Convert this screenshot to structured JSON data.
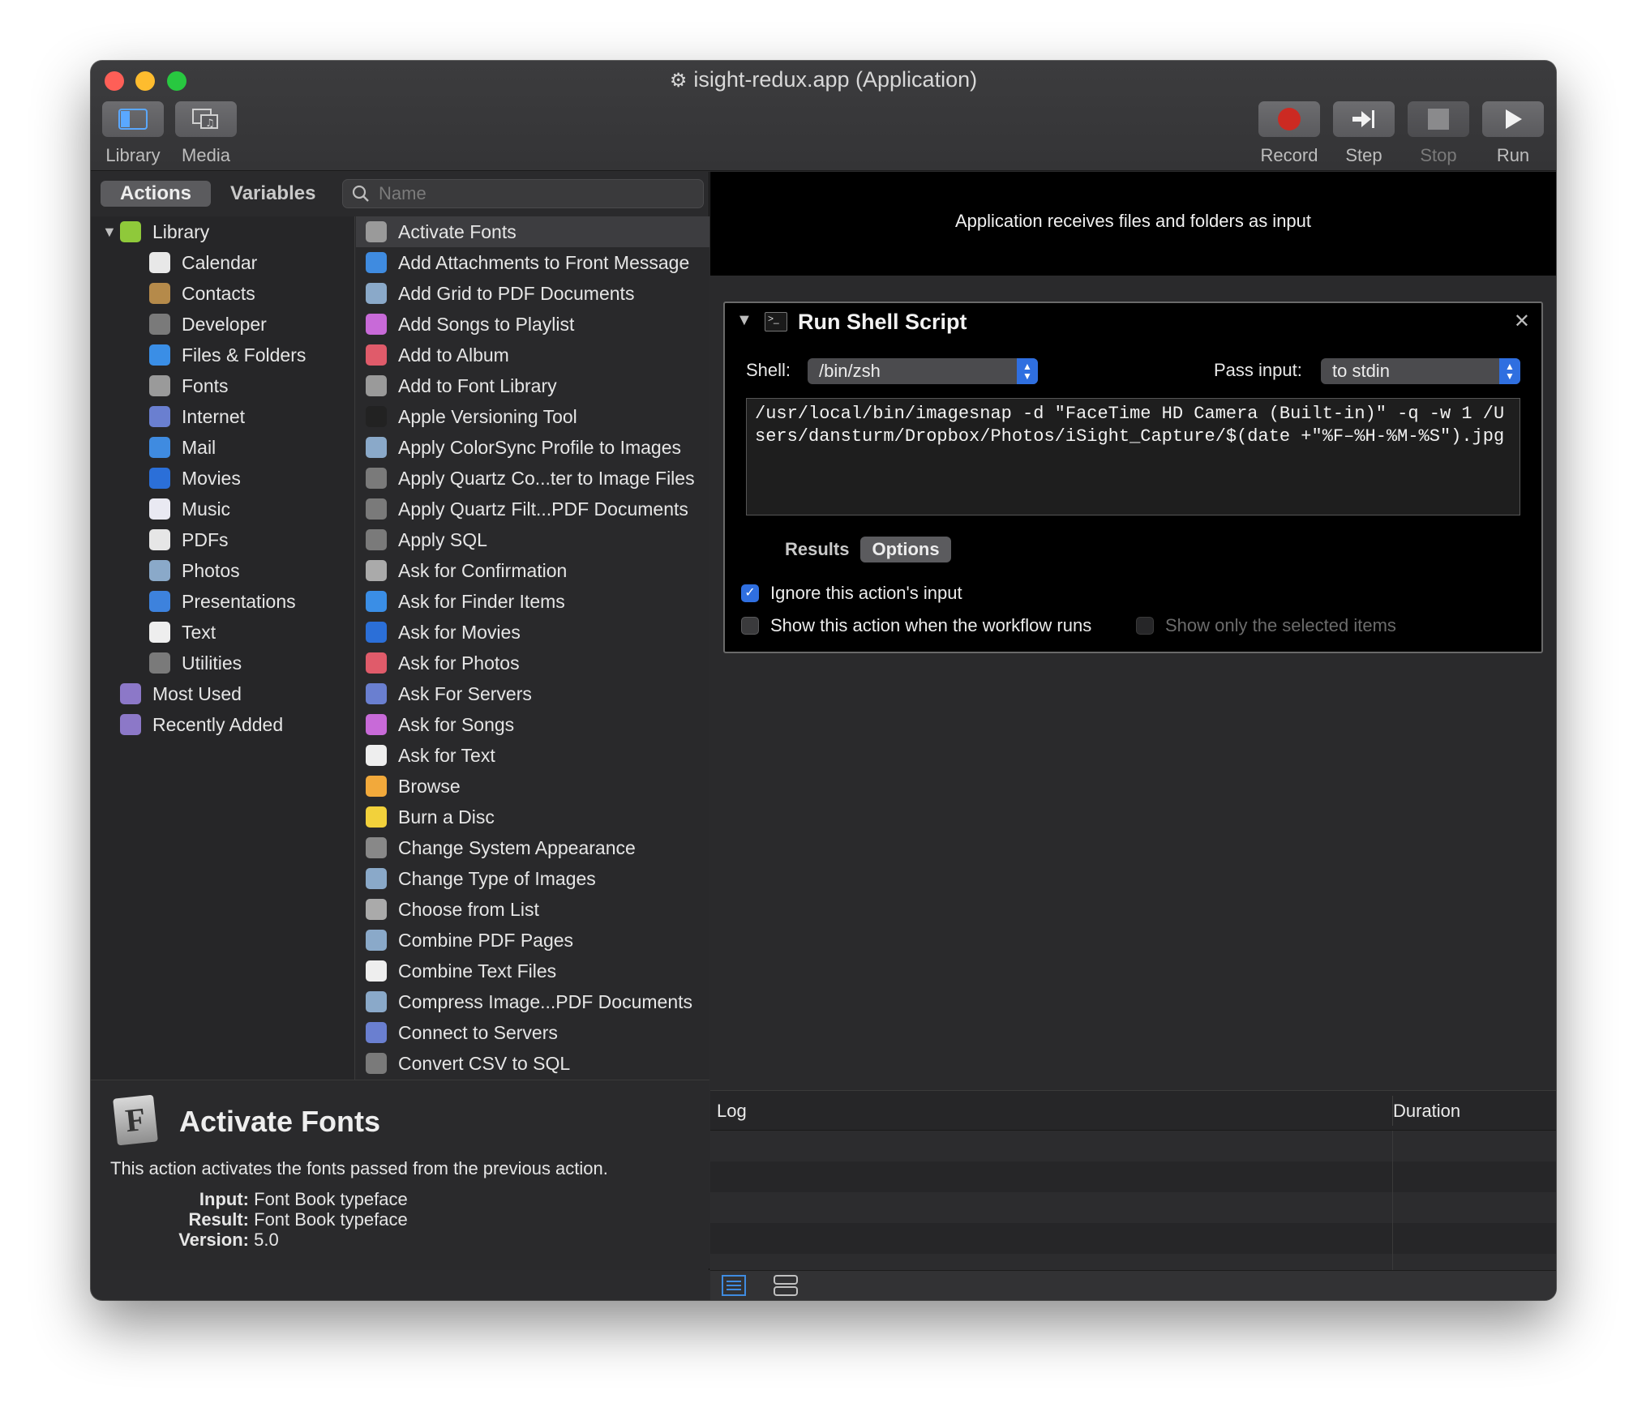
{
  "window": {
    "title": "isight-redux.app (Application)"
  },
  "toolbar": {
    "library_label": "Library",
    "media_label": "Media",
    "record_label": "Record",
    "step_label": "Step",
    "stop_label": "Stop",
    "run_label": "Run"
  },
  "left_tabs": {
    "actions": "Actions",
    "variables": "Variables"
  },
  "search": {
    "placeholder": "Name",
    "value": ""
  },
  "categories": [
    {
      "label": "Library",
      "icon": "library-icon",
      "color": "#8fc93a"
    },
    {
      "label": "Calendar",
      "icon": "calendar-icon",
      "color": "#e8e8e8"
    },
    {
      "label": "Contacts",
      "icon": "contacts-icon",
      "color": "#b58a4a"
    },
    {
      "label": "Developer",
      "icon": "developer-icon",
      "color": "#7a7a7a"
    },
    {
      "label": "Files & Folders",
      "icon": "finder-icon",
      "color": "#3a8ee6"
    },
    {
      "label": "Fonts",
      "icon": "fonts-icon",
      "color": "#9a9a9a"
    },
    {
      "label": "Internet",
      "icon": "globe-icon",
      "color": "#6a7fd0"
    },
    {
      "label": "Mail",
      "icon": "mail-icon",
      "color": "#3f8be0"
    },
    {
      "label": "Movies",
      "icon": "movies-icon",
      "color": "#2b6fd8"
    },
    {
      "label": "Music",
      "icon": "music-icon",
      "color": "#e9e9f2"
    },
    {
      "label": "PDFs",
      "icon": "pdf-icon",
      "color": "#e6e6e6"
    },
    {
      "label": "Photos",
      "icon": "photos-icon",
      "color": "#8aa9c9"
    },
    {
      "label": "Presentations",
      "icon": "presentations-icon",
      "color": "#3d82dd"
    },
    {
      "label": "Text",
      "icon": "text-icon",
      "color": "#eeeeee"
    },
    {
      "label": "Utilities",
      "icon": "utilities-icon",
      "color": "#7a7a7a"
    },
    {
      "label": "Most Used",
      "icon": "smart-folder-icon",
      "color": "#8c78c8"
    },
    {
      "label": "Recently Added",
      "icon": "smart-folder-icon",
      "color": "#8c78c8"
    }
  ],
  "actions": [
    {
      "label": "Activate Fonts",
      "icon": "fonts-icon",
      "color": "#9a9a9a"
    },
    {
      "label": "Add Attachments to Front Message",
      "icon": "mail-icon",
      "color": "#3f8be0"
    },
    {
      "label": "Add Grid to PDF Documents",
      "icon": "preview-icon",
      "color": "#8aa9c9"
    },
    {
      "label": "Add Songs to Playlist",
      "icon": "music-icon",
      "color": "#c86ad8"
    },
    {
      "label": "Add to Album",
      "icon": "photos-icon",
      "color": "#e05b6a"
    },
    {
      "label": "Add to Font Library",
      "icon": "fonts-icon",
      "color": "#9a9a9a"
    },
    {
      "label": "Apple Versioning Tool",
      "icon": "terminal-icon",
      "color": "#222222"
    },
    {
      "label": "Apply ColorSync Profile to Images",
      "icon": "preview-icon",
      "color": "#8aa9c9"
    },
    {
      "label": "Apply Quartz Co...ter to Image Files",
      "icon": "developer-icon",
      "color": "#7a7a7a"
    },
    {
      "label": "Apply Quartz Filt...PDF Documents",
      "icon": "developer-icon",
      "color": "#7a7a7a"
    },
    {
      "label": "Apply SQL",
      "icon": "developer-icon",
      "color": "#7a7a7a"
    },
    {
      "label": "Ask for Confirmation",
      "icon": "automator-icon",
      "color": "#aaaaaa"
    },
    {
      "label": "Ask for Finder Items",
      "icon": "finder-icon",
      "color": "#3a8ee6"
    },
    {
      "label": "Ask for Movies",
      "icon": "movies-icon",
      "color": "#2b6fd8"
    },
    {
      "label": "Ask for Photos",
      "icon": "photos-icon",
      "color": "#e05b6a"
    },
    {
      "label": "Ask For Servers",
      "icon": "globe-icon",
      "color": "#6a7fd0"
    },
    {
      "label": "Ask for Songs",
      "icon": "music-icon",
      "color": "#c86ad8"
    },
    {
      "label": "Ask for Text",
      "icon": "text-icon",
      "color": "#eeeeee"
    },
    {
      "label": "Browse",
      "icon": "browse-icon",
      "color": "#f2a93b"
    },
    {
      "label": "Burn a Disc",
      "icon": "burn-icon",
      "color": "#f2d13b"
    },
    {
      "label": "Change System Appearance",
      "icon": "appearance-icon",
      "color": "#888888"
    },
    {
      "label": "Change Type of Images",
      "icon": "preview-icon",
      "color": "#8aa9c9"
    },
    {
      "label": "Choose from List",
      "icon": "automator-icon",
      "color": "#aaaaaa"
    },
    {
      "label": "Combine PDF Pages",
      "icon": "preview-icon",
      "color": "#8aa9c9"
    },
    {
      "label": "Combine Text Files",
      "icon": "text-icon",
      "color": "#eeeeee"
    },
    {
      "label": "Compress Image...PDF Documents",
      "icon": "preview-icon",
      "color": "#8aa9c9"
    },
    {
      "label": "Connect to Servers",
      "icon": "globe-icon",
      "color": "#6a7fd0"
    },
    {
      "label": "Convert CSV to SQL",
      "icon": "developer-icon",
      "color": "#7a7a7a"
    }
  ],
  "detail": {
    "title": "Activate Fonts",
    "description": "This action activates the fonts passed from the previous action.",
    "input_label": "Input:",
    "input_value": "Font Book typeface",
    "result_label": "Result:",
    "result_value": "Font Book typeface",
    "version_label": "Version:",
    "version_value": "5.0"
  },
  "workflow": {
    "header": "Application receives files and folders as input",
    "action": {
      "title": "Run Shell Script",
      "shell_label": "Shell:",
      "shell_value": "/bin/zsh",
      "pass_input_label": "Pass input:",
      "pass_input_value": "to stdin",
      "script": "/usr/local/bin/imagesnap -d \"FaceTime HD Camera (Built-in)\" -q -w 1 /Users/dansturm/Dropbox/Photos/iSight_Capture/$(date +\"%F–%H-%M-%S\").jpg",
      "tab_results": "Results",
      "tab_options": "Options",
      "ignore_input_label": "Ignore this action's input",
      "ignore_input_checked": true,
      "show_action_label": "Show this action when the workflow runs",
      "show_action_checked": false,
      "show_selected_label": "Show only the selected items",
      "show_selected_checked": false
    }
  },
  "log": {
    "col_log": "Log",
    "col_duration": "Duration"
  },
  "colors": {
    "accent_blue": "#2f6fe0",
    "record_red": "#cc2a22"
  }
}
